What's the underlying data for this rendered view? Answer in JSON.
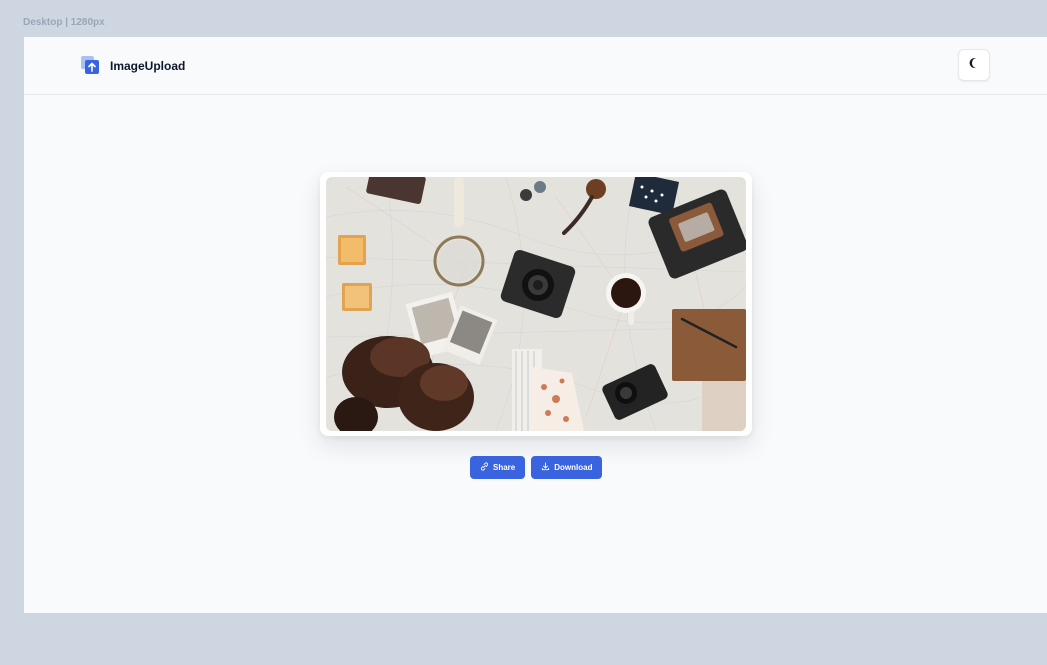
{
  "frame_label": "Desktop | 1280px",
  "header": {
    "brand": "ImageUpload",
    "theme_toggle_icon": "moon-icon"
  },
  "image": {
    "icon": "photo-image"
  },
  "actions": {
    "share_label": "Share",
    "share_icon": "link-icon",
    "download_label": "Download",
    "download_icon": "download-icon"
  },
  "colors": {
    "accent": "#3a63e0",
    "page_bg": "#f8fafc",
    "outer_bg": "#cdd6e1"
  }
}
